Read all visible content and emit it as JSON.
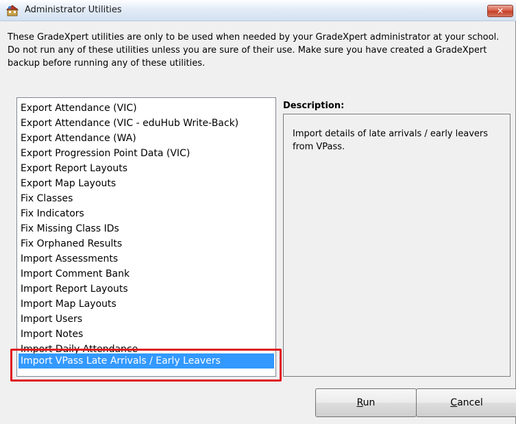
{
  "window": {
    "title": "Administrator Utilities",
    "close_glyph": "✕"
  },
  "instructions": "These GradeXpert utilities are only to be used when needed by your GradeXpert administrator at your school. Do not run any of these utilities unless you are sure of their use. Make sure you have created a GradeXpert backup before running any of these utilities.",
  "utilities_list": {
    "items": [
      "Export Attendance (VIC)",
      "Export Attendance (VIC - eduHub Write-Back)",
      "Export Attendance (WA)",
      "Export Progression Point Data (VIC)",
      "Export Report Layouts",
      "Export Map Layouts",
      "Fix Classes",
      "Fix Indicators",
      "Fix Missing Class IDs",
      "Fix Orphaned Results",
      "Import Assessments",
      "Import Comment Bank",
      "Import Report Layouts",
      "Import Map Layouts",
      "Import Users",
      "Import Notes",
      "Import Daily Attendance",
      "Import VPass Late Arrivals / Early Leavers"
    ],
    "selected": "Import VPass Late Arrivals / Early Leavers",
    "selection_color": "#3399ff",
    "highlight_color": "#e0161c"
  },
  "description": {
    "label": "Description:",
    "text": "Import details of late arrivals / early leavers from VPass."
  },
  "buttons": {
    "run": {
      "mnemonic": "R",
      "rest": "un"
    },
    "cancel": {
      "mnemonic": "C",
      "rest": "ancel"
    }
  },
  "icons": {
    "app": "app-icon",
    "close": "close-icon"
  }
}
